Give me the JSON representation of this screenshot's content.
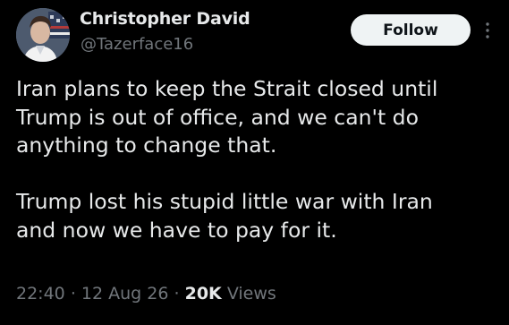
{
  "post": {
    "author": {
      "display_name": "Christopher David",
      "handle": "@Tazerface16",
      "avatar_icon": "profile-photo"
    },
    "follow_label": "Follow",
    "more_icon": "vertical-ellipsis-icon",
    "body": {
      "paragraph_1": [
        "Iran plans to keep the Strait closed until",
        "Trump is out of office, and we can't do",
        "anything to change that."
      ],
      "paragraph_2": [
        "Trump lost his stupid little war with Iran",
        "and now we have to pay for it."
      ]
    },
    "meta": {
      "time": "22:40",
      "separator": "·",
      "date": "12 Aug 26",
      "views_count": "20K",
      "views_label": "Views"
    }
  },
  "colors": {
    "background": "#000000",
    "primary_text": "#e7e9ea",
    "secondary_text": "#71767b",
    "follow_button_bg": "#eff3f4",
    "follow_button_text": "#0f1419"
  }
}
